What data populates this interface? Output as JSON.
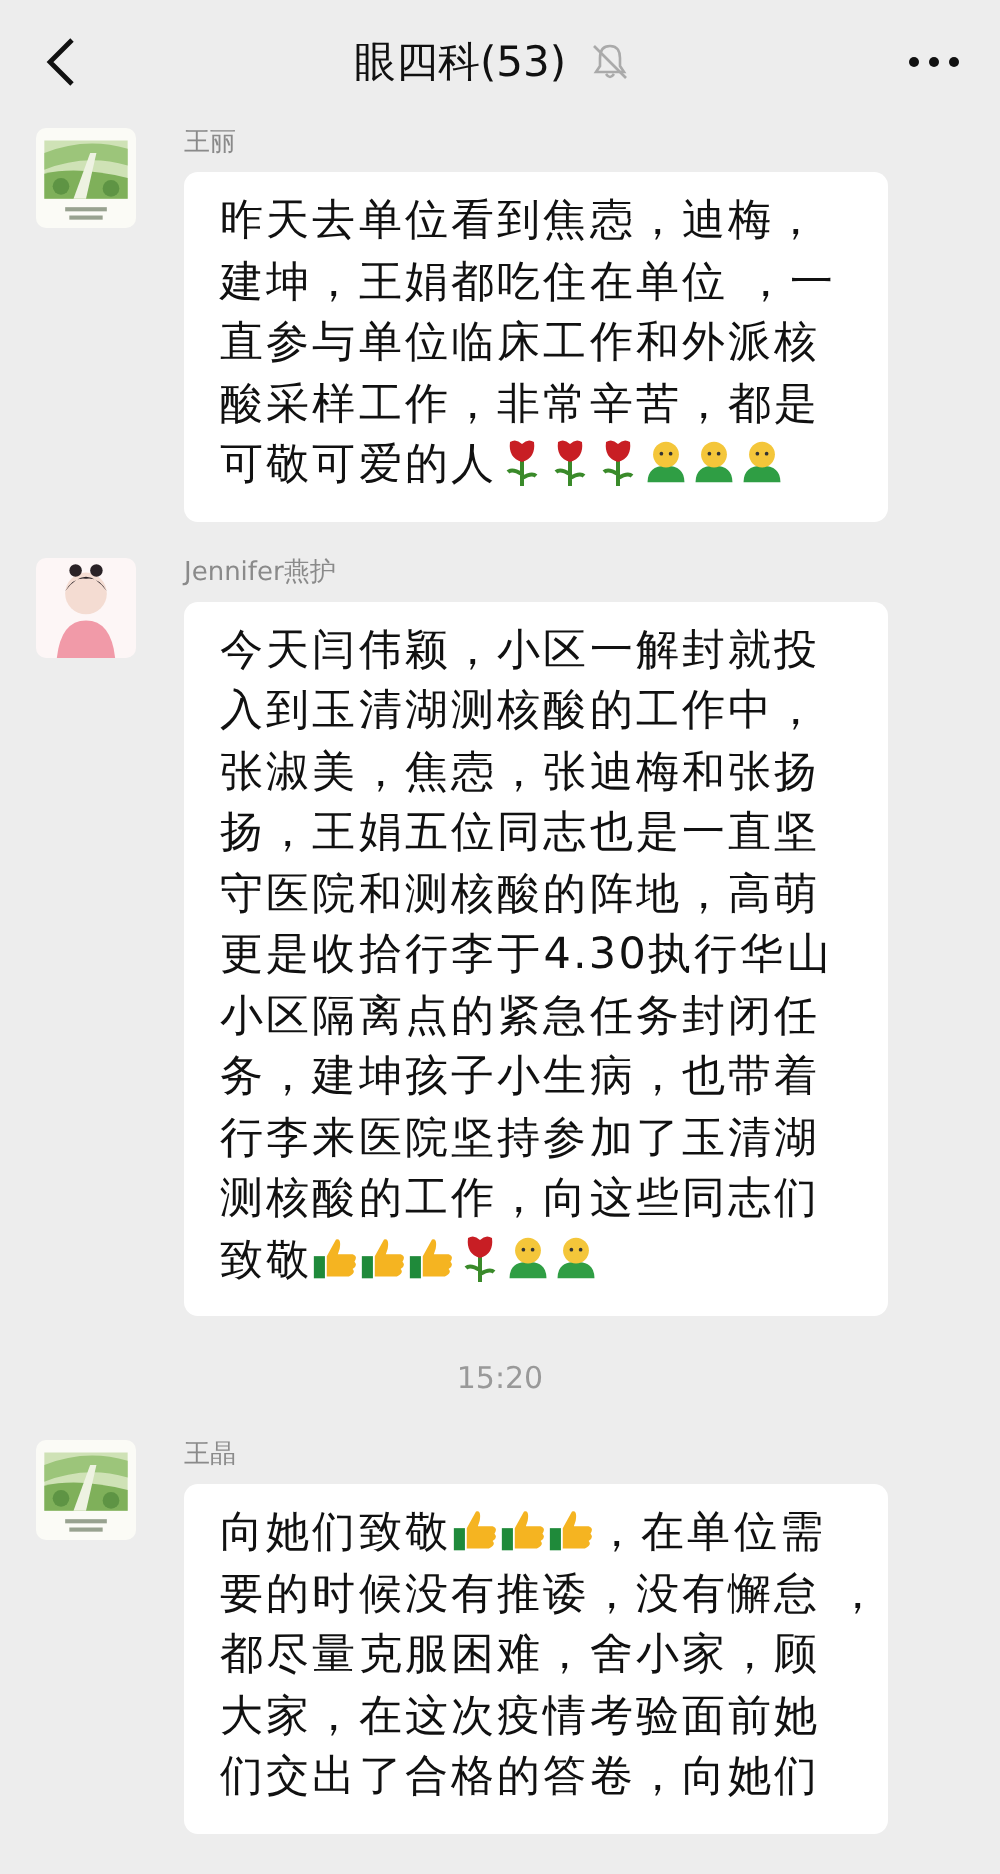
{
  "header": {
    "title": "眼四科(53)",
    "muted": true
  },
  "messages": [
    {
      "kind": "message",
      "sender": "王丽",
      "lines": [
        [
          {
            "kind": "text",
            "text": "昨天去单位看到焦悫，迪梅，"
          }
        ],
        [
          {
            "kind": "text",
            "text": "建坤，王娟都吃住在单位 ，一"
          }
        ],
        [
          {
            "kind": "text",
            "text": "直参与单位临床工作和外派核"
          }
        ],
        [
          {
            "kind": "text",
            "text": "酸采样工作，非常辛苦，都是"
          }
        ],
        [
          {
            "kind": "text",
            "text": "可敬可爱的人"
          },
          {
            "kind": "rose"
          },
          {
            "kind": "rose"
          },
          {
            "kind": "rose"
          },
          {
            "kind": "figure"
          },
          {
            "kind": "figure"
          },
          {
            "kind": "figure"
          }
        ]
      ]
    },
    {
      "kind": "message",
      "sender": "Jennifer燕护",
      "lines": [
        [
          {
            "kind": "text",
            "text": "今天闫伟颖，小区一解封就投"
          }
        ],
        [
          {
            "kind": "text",
            "text": "入到玉清湖测核酸的工作中，"
          }
        ],
        [
          {
            "kind": "text",
            "text": "张淑美，焦悫，张迪梅和张扬"
          }
        ],
        [
          {
            "kind": "text",
            "text": "扬，王娟五位同志也是一直坚"
          }
        ],
        [
          {
            "kind": "text",
            "text": "守医院和测核酸的阵地，高萌"
          }
        ],
        [
          {
            "kind": "text",
            "text": "更是收拾行李于4.30执行华山"
          }
        ],
        [
          {
            "kind": "text",
            "text": "小区隔离点的紧急任务封闭任"
          }
        ],
        [
          {
            "kind": "text",
            "text": "务，建坤孩子小生病，也带着"
          }
        ],
        [
          {
            "kind": "text",
            "text": "行李来医院坚持参加了玉清湖"
          }
        ],
        [
          {
            "kind": "text",
            "text": "测核酸的工作，向这些同志们"
          }
        ],
        [
          {
            "kind": "text",
            "text": "致敬"
          },
          {
            "kind": "thumb"
          },
          {
            "kind": "thumb"
          },
          {
            "kind": "thumb"
          },
          {
            "kind": "rose"
          },
          {
            "kind": "figure"
          },
          {
            "kind": "figure"
          }
        ]
      ]
    },
    {
      "kind": "time",
      "text": "15:20"
    },
    {
      "kind": "message",
      "sender": "王晶",
      "lines": [
        [
          {
            "kind": "text",
            "text": "向她们致敬"
          },
          {
            "kind": "thumb"
          },
          {
            "kind": "thumb"
          },
          {
            "kind": "thumb"
          },
          {
            "kind": "text",
            "text": "，在单位需"
          }
        ],
        [
          {
            "kind": "text",
            "text": "要的时候没有推诿，没有懈怠 ，"
          }
        ],
        [
          {
            "kind": "text",
            "text": "都尽量克服困难，舍小家，顾"
          }
        ],
        [
          {
            "kind": "text",
            "text": "大家，在这次疫情考验面前她"
          }
        ],
        [
          {
            "kind": "text",
            "text": "们交出了合格的答卷，向她们"
          }
        ]
      ]
    }
  ]
}
